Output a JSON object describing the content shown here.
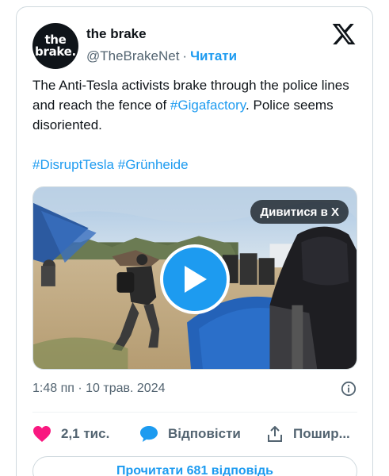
{
  "author": {
    "avatar_line1": "the",
    "avatar_line2": "brake.",
    "name": "the brake",
    "handle": "@TheBrakeNet",
    "separator": "·",
    "follow_label": "Читати"
  },
  "tweet": {
    "text_part1": "The Anti-Tesla activists brake through the police lines and reach the fence of ",
    "hashtag_inline": "#Gigafactory",
    "text_part2": ". Police seems disoriented.",
    "hashtag1": "#DisruptTesla",
    "hashtag2": "#Grünheide"
  },
  "media": {
    "watch_label": "Дивитися в X"
  },
  "meta": {
    "timestamp": "1:48 пп · 10 трав. 2024"
  },
  "actions": {
    "likes": "2,1 тис.",
    "reply_label": "Відповісти",
    "share_label": "Пошир..."
  },
  "footer": {
    "read_replies": "Прочитати 681 відповідь"
  },
  "colors": {
    "accent": "#1d9bf0",
    "like": "#f91880",
    "text": "#0f1419",
    "secondary": "#536471"
  }
}
